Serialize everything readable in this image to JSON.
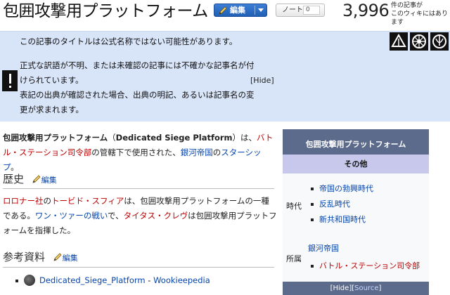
{
  "header": {
    "title": "包囲攻撃用プラットフォーム",
    "edit_label": "編集",
    "note_label": "ノート",
    "note_count": "0",
    "article_count": "3,996",
    "article_caption": "件の記事が\nこのウィキにはあります"
  },
  "notice": {
    "line1": "この記事のタイトルは公式名称ではない可能性があります。",
    "line2": "正式な訳語が不明、または未確認の記事には不確かな記事名が付けられています。",
    "line3": "表記の出典が確認された場合、出典の明記、あるいは記事名の変更が求まれます。",
    "hide_label": "Hide"
  },
  "article": {
    "intro": {
      "bold": "包囲攻撃用プラットフォーム",
      "paren_open": "（",
      "english": "Dedicated Siege Platform",
      "paren_close": "）は、",
      "link1": "バトル・ステーション司令部",
      "mid": "の管轄下で使用された、",
      "link2": "銀河帝国",
      "mid2": "の",
      "link3": "スターシップ",
      "end": "。"
    },
    "history": {
      "heading": "歴史",
      "edit_label": "編集",
      "link1": "ロロナー社",
      "t1": "の",
      "link2": "トービド・スフィア",
      "t2": "は、包囲攻撃用プラットフォームの一種である。",
      "link3": "ワン・ツァーの戦い",
      "t3": "で、",
      "link4": "タイタス・クレヴ",
      "t4": "は包囲攻撃用プラットフォームを指揮した。"
    },
    "references": {
      "heading": "参考資料",
      "edit_label": "編集",
      "link": "Dedicated_Siege_Platform",
      "sep": " - ",
      "source": "Wookieepedia"
    }
  },
  "infobox": {
    "title": "包囲攻撃用プラットフォーム",
    "subtitle": "その他",
    "era_label": "時代",
    "eras": [
      "帝国の勃興時代",
      "反乱時代",
      "新共和国時代"
    ],
    "affiliation_label": "所属",
    "affiliation_top": "銀河帝国",
    "affiliation_sub": "バトル・ステーション司令部",
    "footer_hide": "Hide",
    "footer_source": "Source"
  }
}
